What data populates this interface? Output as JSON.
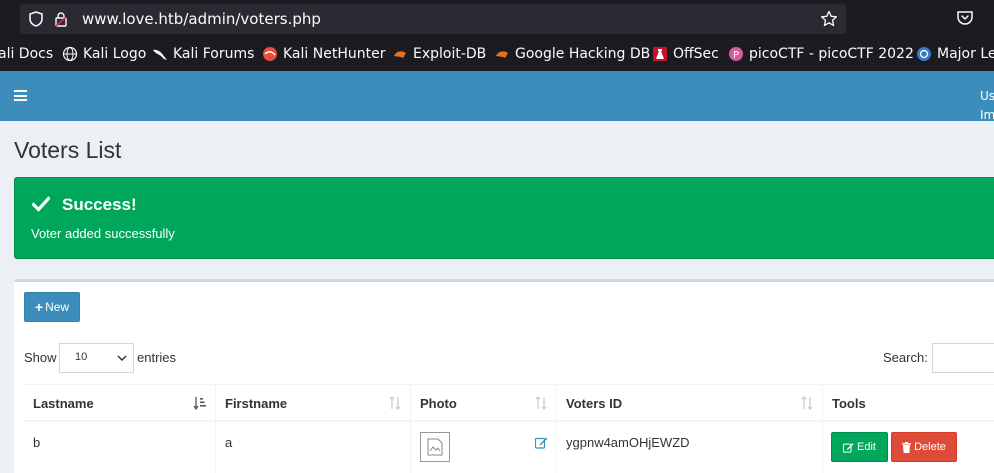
{
  "browser": {
    "url": "www.love.htb/admin/voters.php",
    "bookmarks": [
      {
        "label": "ali Docs",
        "icon": "kali-docs-icon"
      },
      {
        "label": "Kali Logo",
        "icon": "globe-icon"
      },
      {
        "label": "Kali Forums",
        "icon": "kali-dragon-icon"
      },
      {
        "label": "Kali NetHunter",
        "icon": "nethunter-icon"
      },
      {
        "label": "Exploit-DB",
        "icon": "exploitdb-icon"
      },
      {
        "label": "Google Hacking DB",
        "icon": "ghdb-icon"
      },
      {
        "label": "OffSec",
        "icon": "offsec-icon"
      },
      {
        "label": "picoCTF - picoCTF 2022",
        "icon": "picoctf-icon"
      },
      {
        "label": "Major Lea",
        "icon": "major-league-icon"
      }
    ]
  },
  "header": {
    "user_line1": "Us",
    "user_line2": "Im",
    "color": "#3c8dbc"
  },
  "page": {
    "title": "Voters List"
  },
  "alert": {
    "title": "Success!",
    "message": "Voter added successfully",
    "color": "#00a65a"
  },
  "toolbar": {
    "new_label": "New",
    "show_label": "Show",
    "entries_value": "10",
    "entries_label": "entries",
    "search_label": "Search:"
  },
  "table": {
    "columns": [
      "Lastname",
      "Firstname",
      "Photo",
      "Voters ID",
      "Tools"
    ],
    "rows": [
      {
        "lastname": "b",
        "firstname": "a",
        "voters_id": "ygpnw4amOHjEWZD"
      }
    ],
    "edit_label": "Edit",
    "delete_label": "Delete"
  },
  "colors": {
    "edit": "#00a65a",
    "delete": "#dd4b39",
    "primary": "#3c8dbc"
  }
}
